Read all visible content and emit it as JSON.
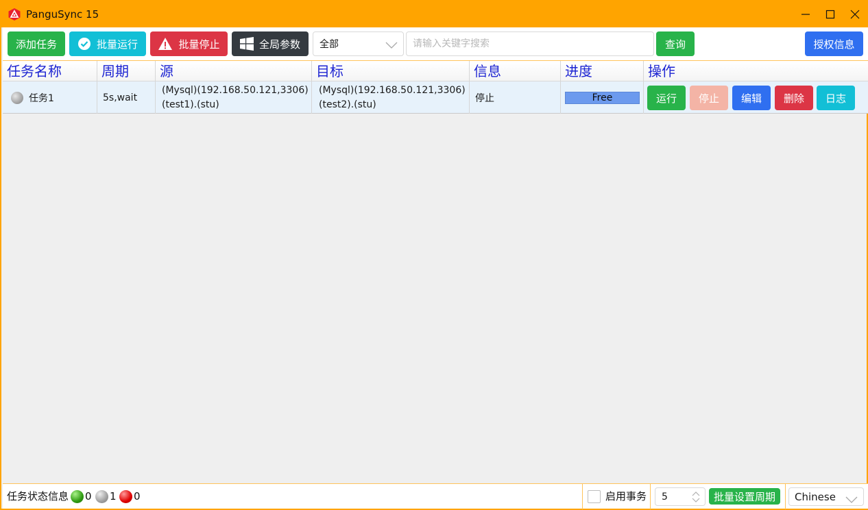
{
  "window": {
    "title": "PanguSync 15",
    "accent_color": "#ffa400",
    "controls": {
      "minimize": "minimize-icon",
      "maximize": "maximize-icon",
      "close": "close-icon"
    }
  },
  "toolbar": {
    "add_task": "添加任务",
    "batch_run": "批量运行",
    "batch_stop": "批量停止",
    "global_params": "全局参数",
    "filter_value": "全部",
    "search_placeholder": "请输入关键字搜索",
    "query": "查询",
    "license_info": "授权信息"
  },
  "table": {
    "columns": [
      "任务名称",
      "周期",
      "源",
      "目标",
      "信息",
      "进度",
      "操作"
    ],
    "rows": [
      {
        "status": "stopped",
        "name": "任务1",
        "cycle": "5s,wait",
        "source_line1": "(Mysql)(192.168.50.121,3306)",
        "source_line2": "(test1).(stu)",
        "target_line1": "(Mysql)(192.168.50.121,3306)",
        "target_line2": "(test2).(stu)",
        "info": "停止",
        "progress_label": "Free",
        "actions": {
          "run": "运行",
          "stop": "停止",
          "edit": "编辑",
          "delete": "删除",
          "log": "日志"
        }
      }
    ]
  },
  "statusbar": {
    "label": "任务状态信息",
    "running_count": "0",
    "stopped_count": "1",
    "error_count": "0",
    "transaction_label": "启用事务",
    "transaction_enabled": false,
    "cycle_value": "5",
    "batch_set_cycle": "批量设置周期",
    "language": "Chinese"
  },
  "colors": {
    "green": "#28b34a",
    "teal": "#12bfd6",
    "red": "#dc3545",
    "dark": "#343a40",
    "blue": "#2f6ff0",
    "header_text": "#1d24d2",
    "progress": "#6c9aee"
  }
}
